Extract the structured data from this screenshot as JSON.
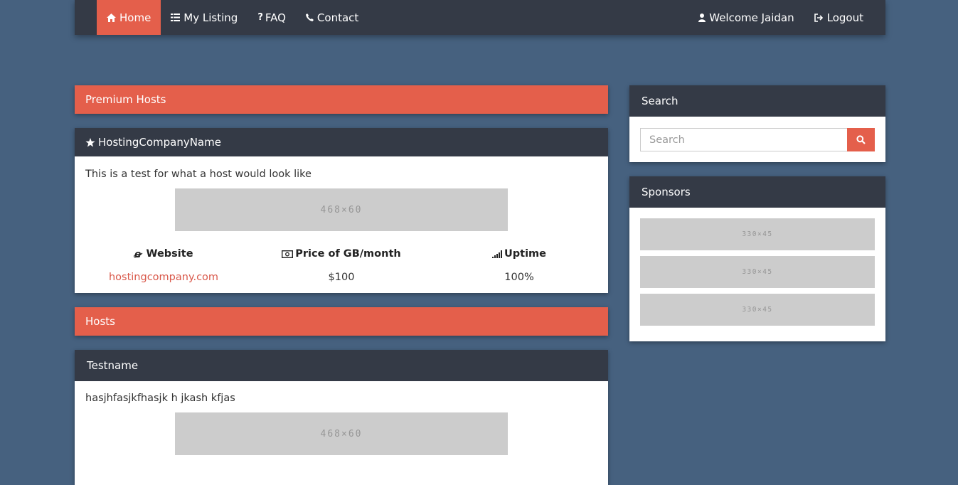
{
  "nav": {
    "left": [
      {
        "label": "Home",
        "icon": "home-icon",
        "active": true
      },
      {
        "label": "My Listing",
        "icon": "list-icon"
      },
      {
        "label": "FAQ",
        "icon": "question-icon"
      },
      {
        "label": "Contact",
        "icon": "phone-icon"
      }
    ],
    "welcome": "Welcome Jaidan",
    "logout": "Logout"
  },
  "premium": {
    "heading": "Premium Hosts",
    "card": {
      "name": "HostingCompanyName",
      "description": "This is a test for what a host would look like",
      "banner": "468×60",
      "labels": {
        "website": "Website",
        "price": "Price of GB/month",
        "uptime": "Uptime"
      },
      "values": {
        "website": "hostingcompany.com",
        "price": "$100",
        "uptime": "100%"
      }
    }
  },
  "hosts": {
    "heading": "Hosts",
    "card": {
      "name": "Testname",
      "description": "hasjhfasjkfhasjk h jkash kfjas",
      "banner": "468×60"
    }
  },
  "search": {
    "heading": "Search",
    "placeholder": "Search"
  },
  "sponsors": {
    "heading": "Sponsors",
    "ads": [
      "330×45",
      "330×45",
      "330×45"
    ]
  },
  "colors": {
    "background": "#46617f",
    "accent": "#e45f4b",
    "dark": "#343a46"
  }
}
